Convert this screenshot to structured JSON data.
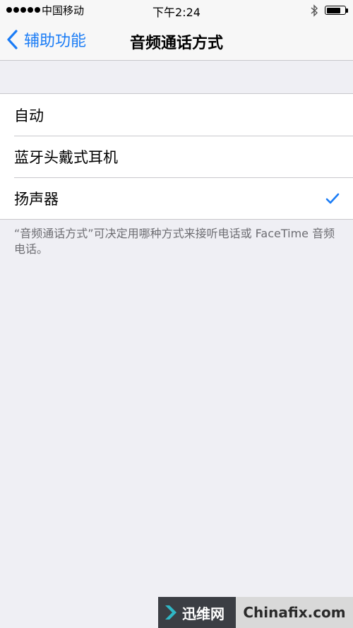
{
  "status_bar": {
    "carrier": "中国移动",
    "time": "下午2:24"
  },
  "nav": {
    "back_label": "辅助功能",
    "title": "音频通话方式"
  },
  "options": [
    {
      "label": "自动",
      "selected": false
    },
    {
      "label": "蓝牙头戴式耳机",
      "selected": false
    },
    {
      "label": "扬声器",
      "selected": true
    }
  ],
  "footnote": "“音频通话方式”可决定用哪种方式来接听电话或 FaceTime 音频电话。",
  "watermark": {
    "cn": "迅维网",
    "en": "Chinafix.com"
  },
  "colors": {
    "accent": "#1a7cf6",
    "background": "#efeff4"
  }
}
